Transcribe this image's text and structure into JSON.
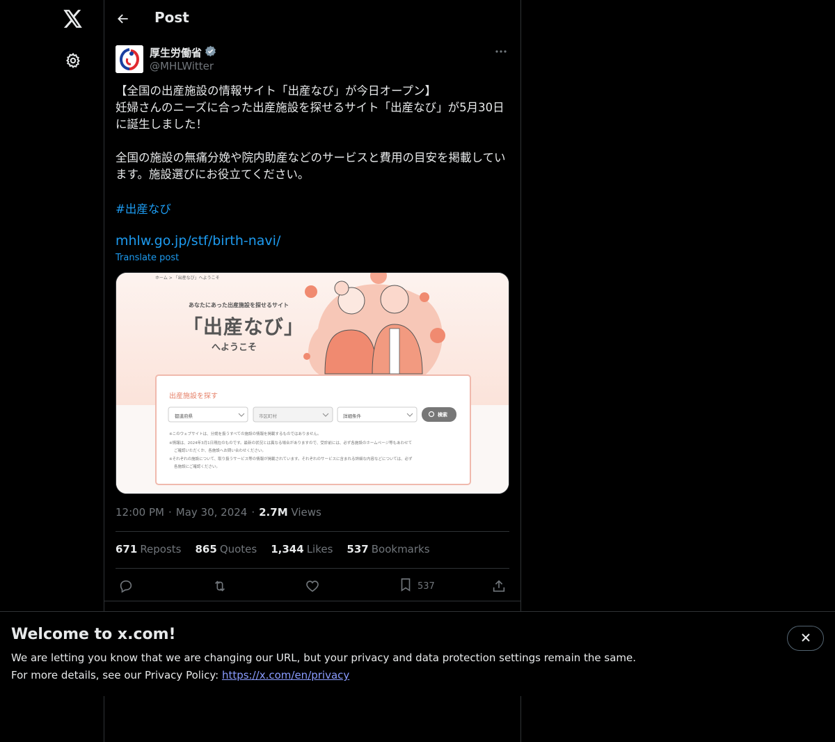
{
  "nav": {
    "logo_icon": "x-logo-icon",
    "settings_icon": "gear-icon"
  },
  "header": {
    "title": "Post"
  },
  "author": {
    "name": "厚生労働省",
    "handle": "@MHLWitter",
    "verified": true
  },
  "post": {
    "text": "【全国の出産施設の情報サイト「出産なび」が今日オープン】\n妊婦さんのニーズに合った出産施設を探せるサイト「出産なび」が5月30日に誕生しました！\n\n全国の施設の無痛分娩や院内助産などのサービスと費用の目安を掲載しています。施設選びにお役立てください。",
    "hashtag": "#出産なび",
    "link": "mhlw.go.jp/stf/birth-navi/",
    "translate_label": "Translate post"
  },
  "media": {
    "breadcrumb": "ホーム > 「出産なび」へようこそ",
    "tagline": "あなたにあった出産施設を探せるサイト",
    "site_name": "「出産なび」",
    "welcome": "へようこそ",
    "search_title": "出産施設を探す",
    "select_prefecture": "都道府県",
    "select_city": "市区町村",
    "select_detail": "詳細条件",
    "search_button": "検索",
    "note1": "※このウェブサイトは、分娩を扱うすべての施設の情報を掲載するものではありません。",
    "note2": "※情報は、2024年3月1日現在のものです。最新の状況とは異なる場合がありますので、受診前には、必ず各施設のホームページ等もあわせて",
    "note2b": "ご確認いただくか、各施設へお問い合わせください。",
    "note3": "※それぞれの施設について、取り扱うサービス等の情報が掲載されています。それぞれのサービスに含まれる詳細な内容などについては、必ず",
    "note3b": "各施設にご確認ください。"
  },
  "meta": {
    "time": "12:00 PM",
    "date": "May 30, 2024",
    "views_count": "2.7M",
    "views_label": "Views"
  },
  "stats": {
    "reposts_count": "671",
    "reposts_label": "Reposts",
    "quotes_count": "865",
    "quotes_label": "Quotes",
    "likes_count": "1,344",
    "likes_label": "Likes",
    "bookmarks_count": "537",
    "bookmarks_label": "Bookmarks"
  },
  "actions": {
    "bookmark_count": "537"
  },
  "banner": {
    "title": "Welcome to x.com!",
    "line1": "We are letting you know that we are changing our URL, but your privacy and data protection settings remain the same.",
    "line2_prefix": "For more details, see our Privacy Policy: ",
    "line2_link": "https://x.com/en/privacy"
  },
  "colors": {
    "accent": "#1d9bf0",
    "background": "#000000",
    "muted": "#71767b",
    "border": "#2f3336"
  }
}
